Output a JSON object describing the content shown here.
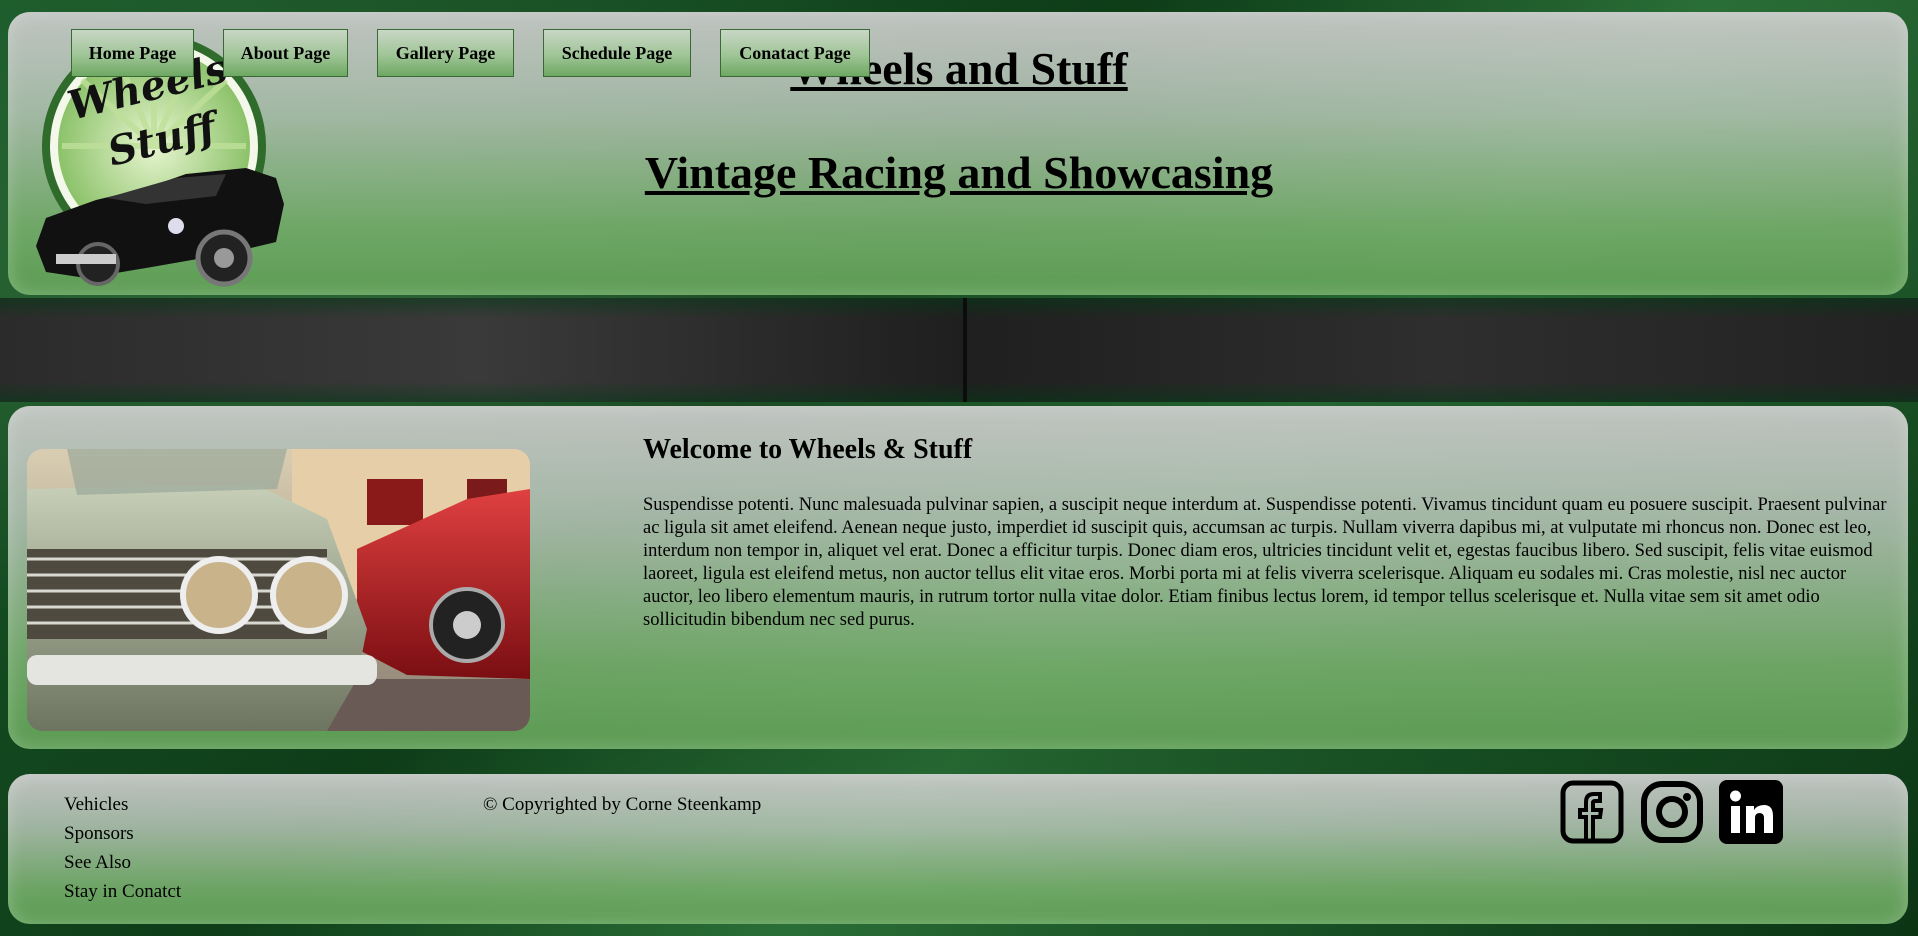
{
  "header": {
    "title": "Wheels and Stuff",
    "subtitle": "Vintage Racing and Showcasing",
    "logo_text_line1": "Wheels",
    "logo_text_line2": "Stuff"
  },
  "nav": {
    "items": [
      {
        "label": "Home Page"
      },
      {
        "label": "About Page"
      },
      {
        "label": "Gallery Page"
      },
      {
        "label": "Schedule Page"
      },
      {
        "label": "Conatact Page"
      }
    ]
  },
  "main": {
    "heading": "Welcome to Wheels & Stuff",
    "paragraph": "Suspendisse potenti. Nunc malesuada pulvinar sapien, a suscipit neque interdum at. Suspendisse potenti. Vivamus tincidunt quam eu posuere suscipit. Praesent pulvinar ac ligula sit amet eleifend. Aenean neque justo, imperdiet id suscipit quis, accumsan ac turpis. Nullam viverra dapibus mi, at vulputate mi rhoncus non. Donec est leo, interdum non tempor in, aliquet vel erat. Donec a efficitur turpis. Donec diam eros, ultricies tincidunt velit et, egestas faucibus libero. Sed suscipit, felis vitae euismod laoreet, ligula est eleifend metus, non auctor tellus elit vitae eros. Morbi porta mi at felis viverra scelerisque. Aliquam eu sodales mi. Cras molestie, nisl nec auctor auctor, leo libero elementum mauris, in rutrum tortor nulla vitae dolor. Etiam finibus lectus lorem, id tempor tellus scelerisque et. Nulla vitae sem sit amet odio sollicitudin bibendum nec sed purus."
  },
  "footer": {
    "links": [
      {
        "label": "Vehicles"
      },
      {
        "label": "Sponsors"
      },
      {
        "label": "See Also"
      },
      {
        "label": "Stay in Conatct"
      }
    ],
    "copyright": "© Copyrighted by Corne Steenkamp",
    "social": [
      {
        "icon": "facebook-icon"
      },
      {
        "icon": "instagram-icon"
      },
      {
        "icon": "linkedin-icon"
      }
    ]
  },
  "colors": {
    "accent_green": "#6ea863",
    "panel_light": "#cdcdcd",
    "background_dark": "#0e3d18"
  }
}
